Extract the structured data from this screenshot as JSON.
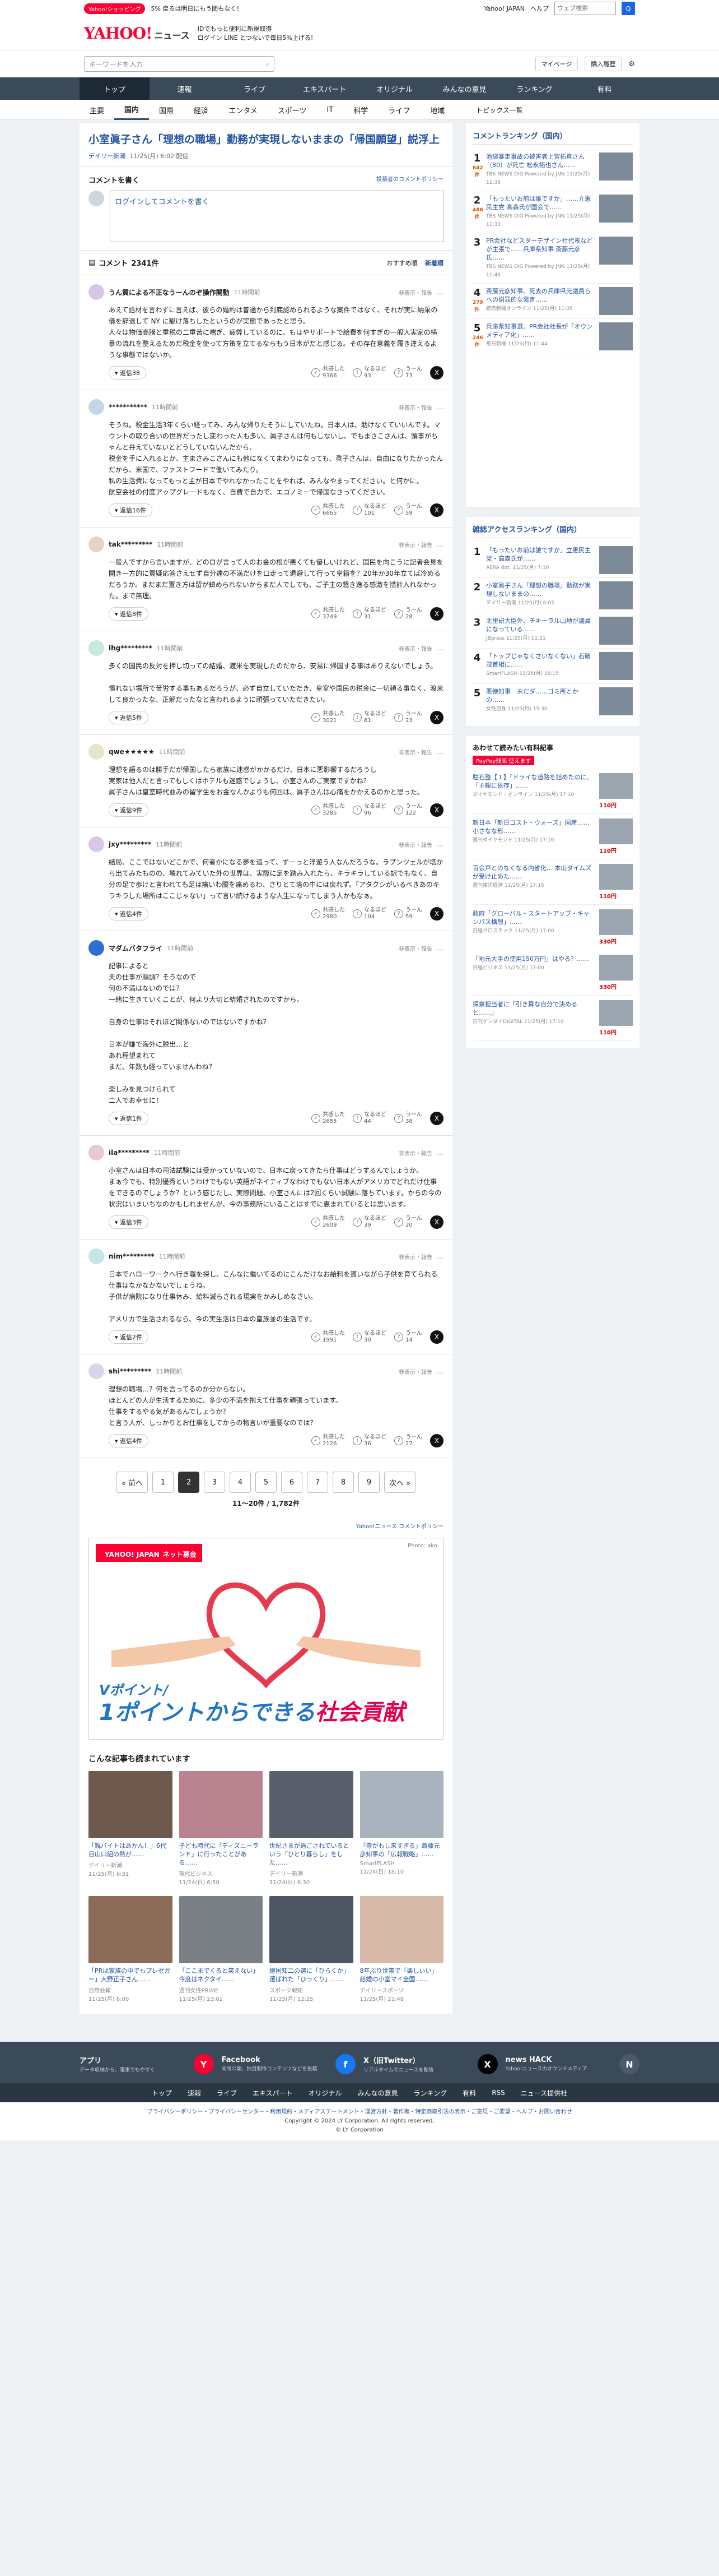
{
  "topstrip": {
    "shopping_badge": "Yahoo!ショッピング",
    "promo": "5% 戻るは明日にもう間もなく！",
    "links": [
      "Yahoo! JAPAN",
      "ヘルプ"
    ],
    "search_placeholder": "ウェブ検索",
    "search_button": "Q"
  },
  "header": {
    "logo": "YAHOO!",
    "logo_sub": "JAPAN",
    "service": "ニュース",
    "msg_line1": "IDでもっと便利に新規取得",
    "msg_line2": "ログイン LINE とつないで毎日5%上げる!",
    "msg_highlight": "新規取得"
  },
  "search": {
    "placeholder": "キーワードを入力",
    "icon": "search-icon",
    "mypage": "マイページ",
    "purchase": "購入履歴",
    "settings_icon": "gear-icon"
  },
  "nav": [
    "トップ",
    "速報",
    "ライブ",
    "エキスパート",
    "オリジナル",
    "みんなの意見",
    "ランキング",
    "有料"
  ],
  "nav_active": 0,
  "subnav": [
    "主要",
    "国内",
    "国際",
    "経済",
    "エンタメ",
    "スポーツ",
    "IT",
    "科学",
    "ライフ",
    "地域"
  ],
  "subnav_active": 1,
  "subnav_right": "トピックス一覧",
  "article": {
    "title": "小室眞子さん「理想の職場」勤務が実現しないままの「帰国願望」説浮上",
    "source": "デイリー新潮",
    "datetime": "11/25(月) 6:02 配信"
  },
  "comment_write": {
    "heading": "コメントを書く",
    "policy_link": "投稿者のコメントポリシー",
    "placeholder": "ログインしてコメントを書く"
  },
  "comments_header": {
    "label": "コメント",
    "count": "2341件",
    "sort_recommended": "おすすめ順",
    "sort_new": "新着順"
  },
  "labels": {
    "non_recommend": "非表示・報告",
    "more": "…",
    "reply_prefix": "返信",
    "share_icon": "X"
  },
  "comments": [
    {
      "name": "うん質による不正なうーんのぞ操作開動",
      "time": "11時間前",
      "body": "あえて話材を言わずに言えば、彼らの婚約は普通から到底認められるような案件ではなく、それが実に納采の儀を辞退して NY に駆け落ちしたというのが実態であったと思う。\n人々は物価高騰と重税の二重苦に喘ぎ、疲弊しているのに、もはやサポートで給費を何すぎの一般人実家の横暴の流れを整えるためだ税金を使って方策を立てるならもう日本がだと感じる。その存在意義を履き違えるような事態ではないか。",
      "reply": "返信38",
      "reactions": [
        [
          "共感した",
          "9366"
        ],
        [
          "なるほど",
          "93"
        ],
        [
          "うーん",
          "73"
        ]
      ]
    },
    {
      "name": "***********",
      "time": "11時間前",
      "body": "そうね。税金生活3年くらい経ってみ、みんな帰りたそうにしていたね。日本人は、助けなくていいんです。マウントの取り合いの世界だったし変わった人も多い。眞子さんは何もしないし、でもまさこさんは、頭事がちゃんと弁えていないとどうしていないんだから、\n税金を手に入れるとか、主まさみこさんにも他になくてまわりになっても、眞子さんは、自由になりたかったんだから、米国で、ファストフードで働いてみたり。\n私の生活費になってもっと主が日本でやれなかったことをやれば、みんなやまってください。と何かに。\n航空会社の付度アップグレードもなく、自費で自力で、エコノミーで帰国なさってください。",
      "reply": "返信16件",
      "reactions": [
        [
          "共感した",
          "6665"
        ],
        [
          "なるほど",
          "101"
        ],
        [
          "うーん",
          "59"
        ]
      ]
    },
    {
      "name": "tak*********",
      "time": "11時間前",
      "body": "一般人ですから言いますが、どのロが言って人のお金の根が悪くても優しいけれど、国民を向こうに記者会見を開き一方的に質疑応答さえせず自分達の不満だけを口走って退避して行って皇籍を？20年か30年立てば冷めるだろうか。まだまだ置き方は留が鎮められないからまだ人でしても、ご子主の懇き逸る感激を惜計入れなかった。まで無理。",
      "reply": "返信8件",
      "reactions": [
        [
          "共感した",
          "3749"
        ],
        [
          "なるほど",
          "31"
        ],
        [
          "うーん",
          "28"
        ]
      ]
    },
    {
      "name": "ihg*********",
      "time": "11時間前",
      "body": "多くの国民の反対を押し切っての結婚、渡米を実現したのだから、安易に帰国する事はありえないでしょう。\n\n慣れない場所で苦労する事もあるだろうが、必ず自立していただき、皇室や国民の税金に一切頼る事なく、渡米して良かったな、正解だったなと言われるように頑張っていただきたい。",
      "reply": "返信5件",
      "reactions": [
        [
          "共感した",
          "3021"
        ],
        [
          "なるほど",
          "61"
        ],
        [
          "うーん",
          "23"
        ]
      ]
    },
    {
      "name": "qwe★★★★★",
      "time": "11時間前",
      "body": "理想を語るのは勝手だが帰国したら家族に迷惑がかかるだけ、日本に悪影響するだろうし\n実家は他人だと言ってもしくはホテルも迷惑でしょうし、小室さんのご実家ですかね？\n眞子さんは皇室時代並みの留学生をお金なんかよりも何回は、眞子さんは心痛をかかえるのかと思った。",
      "reply": "返信9件",
      "reactions": [
        [
          "共感した",
          "3285"
        ],
        [
          "なるほど",
          "96"
        ],
        [
          "うーん",
          "122"
        ]
      ]
    },
    {
      "name": "jxy*********",
      "time": "11時間前",
      "body": "結局、ここではないどこかで、何者かになる夢を追って、ずーっと浮遊う人なんだろうな。ラプンツェルが塔から出てみたものの、壊れてみていた外の世界は、実際に足を踏み入れたら、キラキラしている訳でもなく、自分の足で歩けと言われても足は痛いわ腰を痛めるわ、さりとて塔の中には戻れず。「アタクシがいるべきあのキラキラした場所はここじゃない」って言い続けるような人生になってしまう人かもなぁ。",
      "reply": "返信4件",
      "reactions": [
        [
          "共感した",
          "2980"
        ],
        [
          "なるほど",
          "104"
        ],
        [
          "うーん",
          "59"
        ]
      ]
    },
    {
      "name": "マダムバタフライ",
      "time": "11時間前",
      "body": "記事によると\n夫の仕事が順調？そうなので\n何の不満はないのでは？\n一緒に生きていくことが、何より大切と結婚されたのですから。\n\n自身の仕事はそれほど関係ないのではないですかね？\n\n日本が嫌で海外に脱出…と\nあれ程望まれて\nまだ、年数も経っていませんわね？\n\n楽しみを見つけられて\n二人でお幸せに！",
      "reply": "返信1件",
      "reactions": [
        [
          "共感した",
          "2655"
        ],
        [
          "なるほど",
          "44"
        ],
        [
          "うーん",
          "38"
        ]
      ]
    },
    {
      "name": "ila*********",
      "time": "11時間前",
      "body": "小室さんは日本の司法試験には受かっていないので、日本に戻ってきたら仕事はどうするんでしょうか。\nまぁ今でも、特別優秀というわけでもない英語がネイティブなわけでもない日本人がアメリカでどれだけ仕事をできるのでしょうか？という感じだし、実際問題、小室さんには2回くらい試験に落ちています。からの今の状況はいまいちなのかもしれませんが、今の事務所にいることはすでに恵まれているとは思います。",
      "reply": "返信3件",
      "reactions": [
        [
          "共感した",
          "2609"
        ],
        [
          "なるほど",
          "39"
        ],
        [
          "うーん",
          "20"
        ]
      ]
    },
    {
      "name": "nim*********",
      "time": "11時間前",
      "body": "日本でハローワークへ行き職を探し、こんなに働いてるのにこんだけなお給料を貰いながら子供を育てられる仕事はなかなかないでしょうね。\n子供が病院になり仕事休み、給料減らされる現実をかみしめなさい。\n\nアメリカで生活されるなら、今の実生活は日本の皇族並の生活です。",
      "reply": "返信2件",
      "reactions": [
        [
          "共感した",
          "1991"
        ],
        [
          "なるほど",
          "30"
        ],
        [
          "うーん",
          "14"
        ]
      ]
    },
    {
      "name": "shi*********",
      "time": "11時間前",
      "body": "理想の職場…？何を言ってるのか分からない。\nほとんどの人が生活するために、多少の不満を抱えて仕事を頑張っています。\n仕事をするやる気があるんでしょうか？\nと言う人が、しっかりとお仕事をしてからの物言いが重要なのでは？",
      "reply": "返信4件",
      "reactions": [
        [
          "共感した",
          "2126"
        ],
        [
          "なるほど",
          "36"
        ],
        [
          "うーん",
          "27"
        ]
      ]
    }
  ],
  "pager": {
    "prev": "« 前へ",
    "next": "次へ »",
    "pages": [
      "1",
      "2",
      "3",
      "4",
      "5",
      "6",
      "7",
      "8",
      "9"
    ],
    "current": "2",
    "info": "11〜20件 / 1,782件",
    "policy": "Yahoo!ニュース コメントポリシー"
  },
  "ad": {
    "logo": "YAHOO! JAPAN",
    "logo_sub": "ネット募金",
    "credit": "Photo: ako",
    "line1": "Vポイント/",
    "line2_a": "1ポイントからできる",
    "line2_b": "社会貢献"
  },
  "also_read": {
    "title": "こんな記事も読まれています",
    "items": [
      [
        "「親バイトはあかん！」6代目山口組の熱が……",
        "デイリー新潮",
        "11/25(月) 6:31"
      ],
      [
        "子ども時代に「ディズニーランド」に行ったことがある……",
        "現代ビジネス",
        "11/24(日) 6:50"
      ],
      [
        "世紀さまが過ごされているという「ひとり暮らし」をした……",
        "デイリー新潮",
        "11/24(日) 6:30"
      ],
      [
        "「寺がもし来すぎる」斎藤元彦知事の「広報戦略」……",
        "SmartFLASH",
        "11/24(日) 18:10"
      ],
      [
        "「PRは家族の中でもプレゼガー」大野正子さん……",
        "自然会報",
        "11/25(月) 6:00"
      ],
      [
        "「ここまでくると笑えない」今度はネクタイ……",
        "週刊女性PRIME",
        "11/25(月) 23:02"
      ],
      [
        "継国知二の選に「ひらくか」選ばれた「ひっくり」……",
        "スポーツ報知",
        "11/25(月) 12:25"
      ],
      [
        "8年ぶり世帯で「楽しいい」結婚の小室マイ全国……",
        "デイリースポーツ",
        "11/25(月) 21:48"
      ]
    ]
  },
  "ranking": {
    "title": "コメントランキング（国内）",
    "items": [
      [
        "1",
        "842件",
        "池袋暴走事故の被害者上宮拓真さん（80）が死亡 松永拓也さん……",
        "TBS NEWS DIG Powered by JNN",
        "11/25(月) 11:38"
      ],
      [
        "2",
        "486件",
        "「もったいお前は誰ですか」……立憲民主党 高森氏が国会で……",
        "TBS NEWS DIG Powered by JNN",
        "11/25(月) 11:33"
      ],
      [
        "3",
        "",
        "PR会社などスターデザイン社代表などが主張で……兵庫県知事 斎藤元彦氏……",
        "TBS NEWS DIG Powered by JNN",
        "11/25(月) 11:46"
      ],
      [
        "4",
        "279件",
        "斎藤元彦知事、死去の兵庫県元議員らへの謝罪的な発言……",
        "読売新聞オンライン",
        "11/25(月) 11:05"
      ],
      [
        "5",
        "246件",
        "兵庫県知事選、PR会社社長が「オウンメディア化」……",
        "毎日新聞",
        "11/25(月) 11:44"
      ]
    ]
  },
  "access_ranking": {
    "title": "雑誌アクセスランキング（国内）",
    "items": [
      [
        "1",
        "「もったいお前は誰ですか」立憲民主党・高森氏が……",
        "AERA dot.",
        "11/25(月) 7:30"
      ],
      [
        "2",
        "小室眞子さん「理想の職場」勤務が実現しないままの……",
        "デイリー新潮",
        "11/25(月) 6:02"
      ],
      [
        "3",
        "北里研大臣外、チキーラル山地が議員になっている……",
        "JBpress",
        "11/25(月) 11:21"
      ],
      [
        "4",
        "「トップじゃなくさいなくない」石破茂首相に……",
        "SmartFLASH",
        "11/25(月) 16:15"
      ],
      [
        "5",
        "悪徳知事　未だダ……ゴミ所とかの……",
        "女性自身",
        "11/25(月) 15:30"
      ]
    ]
  },
  "paid": {
    "title": "あわせて読みたい有料記事",
    "brand": "PayPay残高 使えます",
    "items": [
      [
        "駐石整【１】「ドライな道路を詰めたのに、「主観に依存」……",
        "ダイヤモンド・オンライン",
        "11/25(月) 17:10",
        "110円"
      ],
      [
        "新日本「新日コスト・ウォーズ」国産…… 小さなな形…… ",
        "週刊ダイヤモンド",
        "11/25(月) 17:10",
        "110円"
      ],
      [
        "百会戸とのなくなる内省化… 本山タイムズが受け止めた……",
        "週刊東洋経済",
        "11/25(月) 17:15",
        "110円"
      ],
      [
        "政府「グローバル・スタートアップ・キャンパス構想」……",
        "日経クロステック",
        "11/25(月) 17:00",
        "330円"
      ],
      [
        "「地元大手の使用150万円」はやる？……",
        "日経ビジネス",
        "11/25(月) 17:00",
        "330円"
      ],
      [
        "探察担当者に「引き算な自分で決めると……」",
        "日刊ゲンダイDIGITAL",
        "11/25(月) 17:10",
        "110円"
      ]
    ]
  },
  "footer": {
    "cols": [
      [
        "アプリ",
        "データ収納から、電車でもやすく",
        "app-icon",
        "#ff0033",
        "Y"
      ],
      [
        "Facebook",
        "同所公開、独自制作コンテンツなどを投稿",
        "facebook-icon",
        "#1877f2",
        "f"
      ],
      [
        "X（旧Twitter）",
        "リアルタイムでニュースを配信",
        "x-icon",
        "#000000",
        "X"
      ],
      [
        "news HACK",
        "Yahoo!ニュースのオウンドメディア",
        "news-hack-icon",
        "#4b5a68",
        "N"
      ]
    ],
    "nav": [
      "トップ",
      "速報",
      "ライブ",
      "エキスパート",
      "オリジナル",
      "みんなの意見",
      "ランキング",
      "有料",
      "RSS",
      "ニュース提供社"
    ],
    "links": "プライバシーポリシー・プライバシーセンター・利用規約・メディアステートメント・運営方針・著作権・特定商取引法の表示・ご意見・ご要望・ヘルプ・お問い合わせ",
    "copyright": "Copyright © 2024 LY Corporation. All rights reserved.",
    "legal": "© LY Corporation"
  }
}
